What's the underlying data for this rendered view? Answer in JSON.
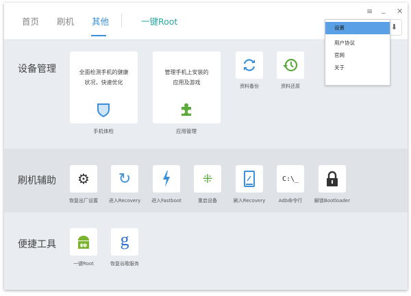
{
  "header": {
    "tabs": [
      {
        "label": "首页"
      },
      {
        "label": "刷机"
      },
      {
        "label": "其他"
      }
    ],
    "active_tab": "其他",
    "root_tab": "一键Root",
    "window_controls": {
      "menu": "≡",
      "minimize": "_",
      "close": "✕"
    }
  },
  "sections": [
    {
      "title": "设备管理",
      "cards": [
        {
          "desc1": "全面检测手机的健康",
          "desc2": "状况，快速优化",
          "label": "手机体检"
        },
        {
          "desc1": "管理手机上安装的",
          "desc2": "应用及游戏",
          "label": "应用管理"
        }
      ],
      "tiles": [
        {
          "label": "资料备份"
        },
        {
          "label": "资料还原"
        }
      ]
    },
    {
      "title": "刷机辅助",
      "tiles": [
        {
          "label": "恢复出厂设置"
        },
        {
          "label": "进入Recovery"
        },
        {
          "label": "进入Fastboot"
        },
        {
          "label": "重启设备"
        },
        {
          "label": "刷入Recovery"
        },
        {
          "label": "Adb命令行",
          "icon_text": "C:\\_"
        },
        {
          "label": "解锁Bootloader"
        }
      ]
    },
    {
      "title": "便捷工具",
      "tiles": [
        {
          "label": "一键Root"
        },
        {
          "label": "恢复谷歌服务",
          "icon_text": "g"
        }
      ]
    }
  ],
  "menu": {
    "items": [
      {
        "label": "设置"
      },
      {
        "label": "用户协议"
      },
      {
        "label": "官网"
      },
      {
        "label": "关于"
      }
    ],
    "selected": "设置"
  },
  "colors": {
    "accent": "#3a8fd8",
    "root": "#2aa6a0",
    "menu_selected": "#5aa0e6",
    "green": "#5aaa3a"
  }
}
